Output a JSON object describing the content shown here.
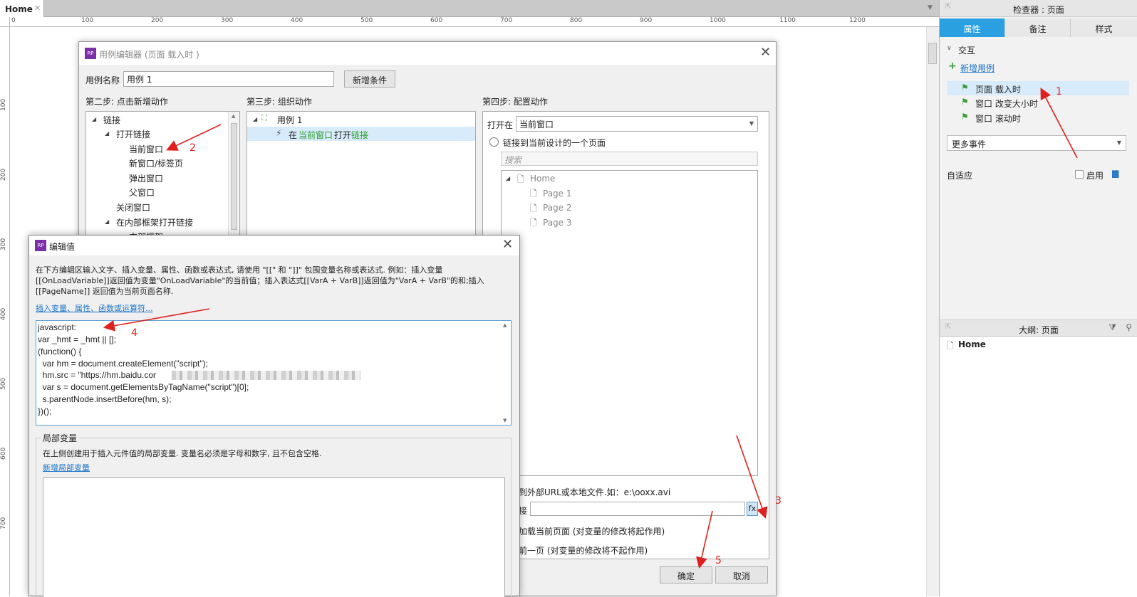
{
  "tabs": {
    "home": "Home"
  },
  "ruler": {
    "h": [
      "0",
      "100",
      "200",
      "300",
      "400",
      "500",
      "600",
      "700",
      "800",
      "900",
      "1000",
      "1100",
      "1200"
    ],
    "v": [
      "100",
      "200",
      "300",
      "400",
      "500",
      "600",
      "700"
    ]
  },
  "inspector": {
    "title": "检查器 : 页面",
    "tabs": [
      "属性",
      "备注",
      "样式"
    ],
    "interaction_label": "交互",
    "add_case": "新增用例",
    "events": [
      "页面 载入时",
      "窗口 改变大小时",
      "窗口 滚动时"
    ],
    "more_events": "更多事件",
    "adaptive": "自适应",
    "enable": "启用",
    "outline_title": "大纲: 页面",
    "outline_home": "Home"
  },
  "case_editor": {
    "title": "用例编辑器 (页面 载入时 )",
    "case_name_label": "用例名称",
    "case_name_value": "用例 1",
    "add_condition": "新增条件",
    "step2": "第二步: 点击新增动作",
    "step3": "第三步: 组织动作",
    "step4": "第四步: 配置动作",
    "actions_tree": [
      "链接",
      "打开链接",
      "当前窗口",
      "新窗口/标签页",
      "弹出窗口",
      "父窗口",
      "关闭窗口",
      "在内部框架打开链接",
      "内部框架"
    ],
    "organize": {
      "case": "用例 1",
      "action_prefix": "在",
      "action_target": "当前窗口",
      "action_verb": "打开",
      "action_link": "链接"
    },
    "open_in_label": "打开在",
    "open_in_value": "当前窗口",
    "link_current_page": "链接到当前设计的一个页面",
    "search_placeholder": "搜索",
    "pages": [
      "Home",
      "Page 1",
      "Page 2",
      "Page 3"
    ],
    "external_url": "到外部URL或本地文件.如：e:\\ooxx.avi",
    "link_label": "接",
    "fx": "fx",
    "reload": "加载当前页面 (对变量的修改将起作用)",
    "back": "前一页 (对变量的修改将不起作用)",
    "ok": "确定",
    "cancel": "取消"
  },
  "value_editor": {
    "title": "编辑值",
    "desc1": "在下方编辑区输入文字、插入变量、属性、函数或表达式, 请使用 \"[[\" 和 \"]]\" 包围变量名称或表达式. 例如：插入变量",
    "desc2": "[[OnLoadVariable]]返回值为变量\"OnLoadVariable\"的当前值；插入表达式[[VarA + VarB]]返回值为\"VarA + VarB\"的和;插入",
    "desc3": "[[PageName]] 返回值为当前页面名称.",
    "insert_link": "插入变量、属性、函数或运算符...",
    "code": [
      "javascript:",
      "var _hmt = _hmt || [];",
      "(function() {",
      "  var hm = document.createElement(\"script\");",
      "  hm.src = \"https://hm.baidu.cor",
      "  var s = document.getElementsByTagName(\"script\")[0];",
      "  s.parentNode.insertBefore(hm, s);",
      "})();"
    ],
    "local_vars": "局部变量",
    "local_desc": "在上侧创建用于插入元件值的局部变量. 变量名必须是字母和数字, 且不包含空格.",
    "add_local": "新增局部变量"
  },
  "annotations": [
    "1",
    "2",
    "3",
    "4",
    "5"
  ],
  "colors": {
    "accent": "#2aa0e0",
    "arrow": "#e0201c",
    "green_icon": "#3b9a3b",
    "purple_logo": "#7b2fa8"
  }
}
